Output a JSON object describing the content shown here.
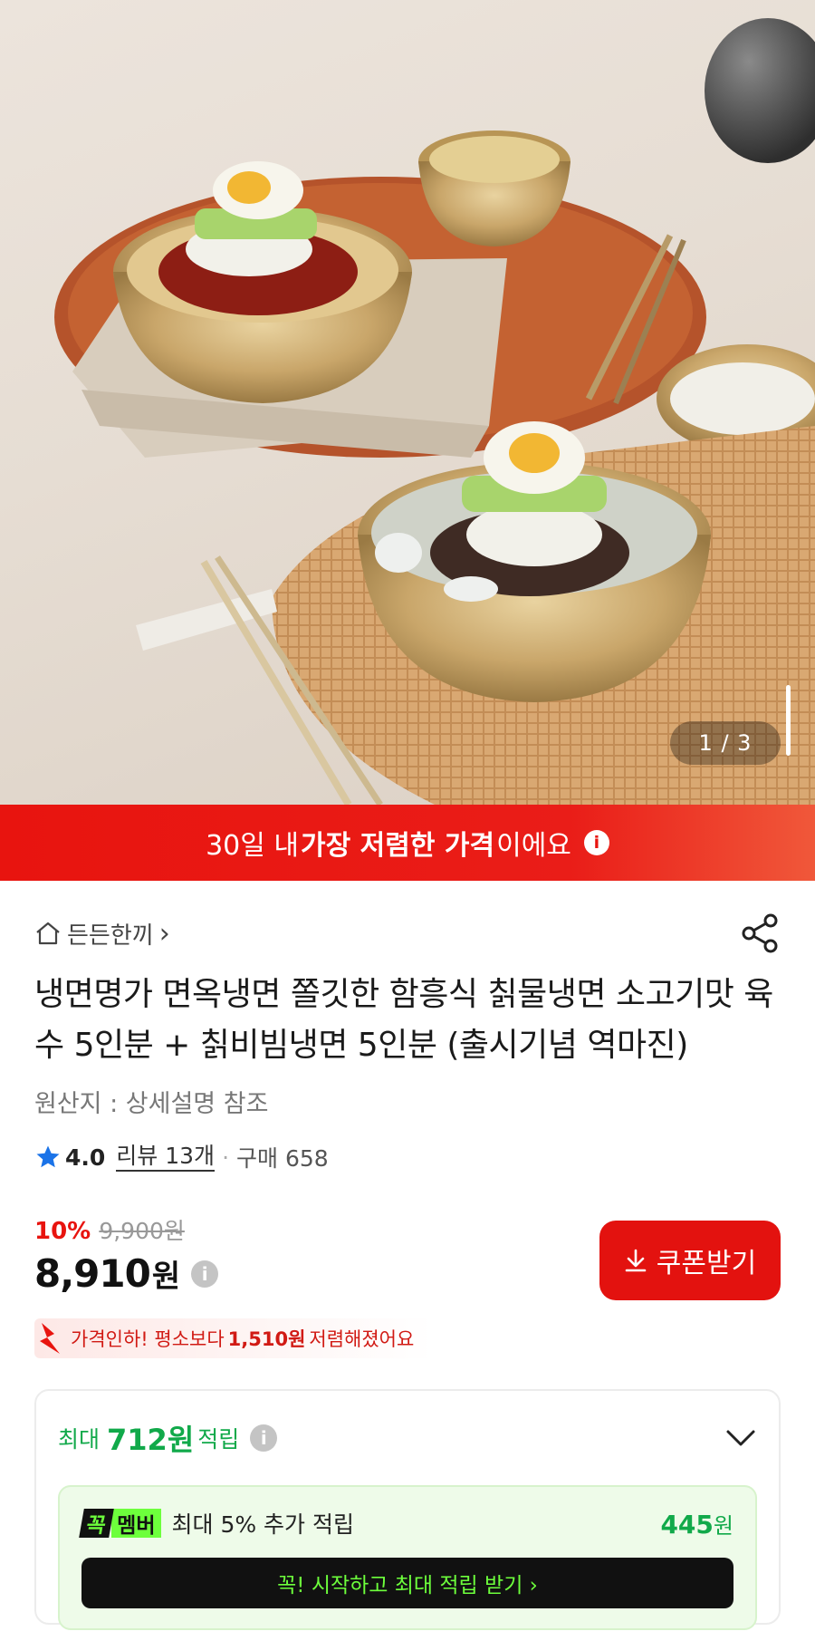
{
  "hero": {
    "counter": "1 / 3"
  },
  "banner": {
    "text_pre": "30일 내 ",
    "text_bold": "가장 저렴한 가격",
    "text_post": "이에요",
    "info_glyph": "i"
  },
  "product": {
    "brand": "든든한끼",
    "brand_chevron": "›",
    "title": "냉면명가 면옥냉면 쫄깃한 함흥식 칡물냉면 소고기맛 육수 5인분 + 칡비빔냉면 5인분 (출시기념 역마진)",
    "origin": "원산지 : 상세설명 참조",
    "rating": "4.0",
    "review": "리뷰 13개",
    "dot": "·",
    "purchase": "구매 658"
  },
  "price": {
    "discount": "10%",
    "original": "9,900원",
    "final": "8,910",
    "won": "원",
    "info_glyph": "i",
    "coupon_label": "쿠폰받기",
    "drop_pre": "가격인하! 평소보다 ",
    "drop_bold": "1,510원",
    "drop_post": " 저렴해졌어요"
  },
  "points": {
    "title_pre": "최대",
    "title_amount": "712원",
    "title_post": "적립",
    "info_glyph": "i",
    "badge_k": "꼭",
    "badge_m": "멤버",
    "member_text": "최대 5% 추가 적립",
    "member_amount": "445",
    "member_won": "원",
    "start_button": "꼭! 시작하고 최대 적립 받기 ›"
  },
  "colors": {
    "accent_red": "#e8140f",
    "points_green": "#11a94a",
    "member_neon": "#6dff3c"
  },
  "icons": [
    "home-icon",
    "share-icon",
    "star-icon",
    "info-icon",
    "download-arrow-icon",
    "price-drop-arrow-icon",
    "chevron-down-icon"
  ]
}
